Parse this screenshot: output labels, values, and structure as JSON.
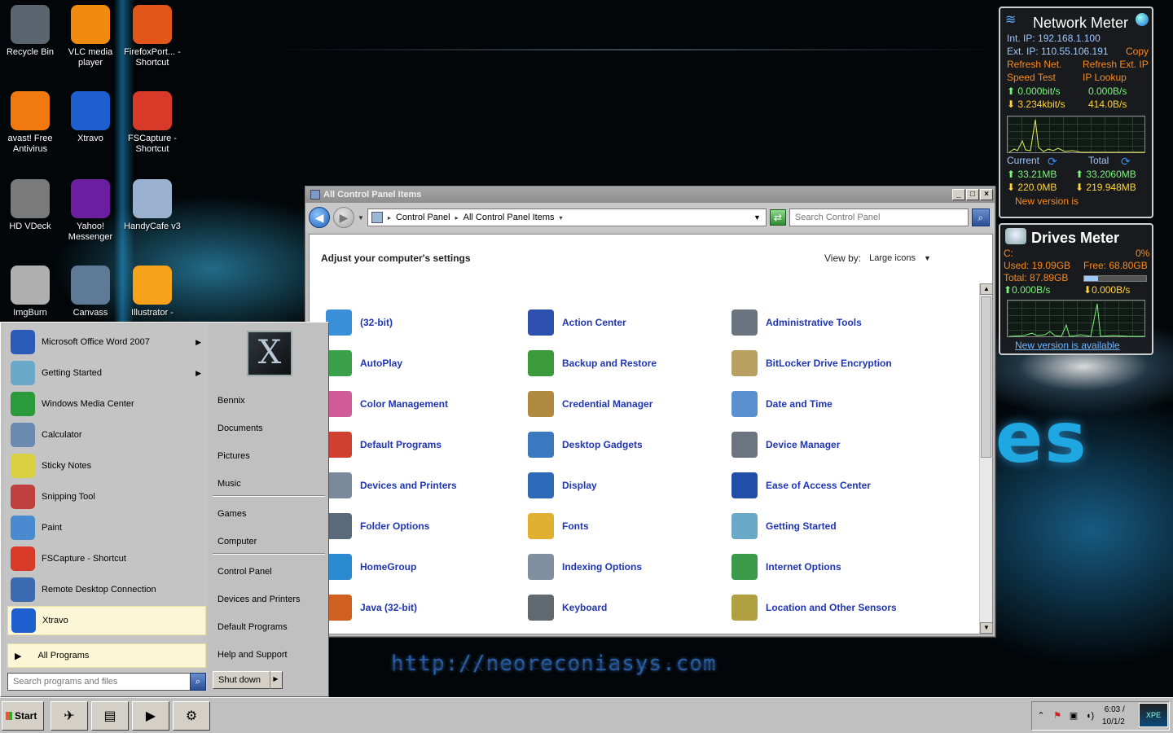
{
  "desktop": {
    "wallpaper_text_es": "es",
    "wallpaper_url": "http://neoreconiasys.com",
    "icons": [
      {
        "label": "Recycle Bin",
        "icon": "recycle-bin-icon",
        "color": "#5a6570"
      },
      {
        "label": "VLC media player",
        "icon": "vlc-cone-icon",
        "color": "#f08a10"
      },
      {
        "label": "FirefoxPort... - Shortcut",
        "icon": "firefox-icon",
        "color": "#e2561a"
      },
      {
        "label": "avast! Free Antivirus",
        "icon": "avast-icon",
        "color": "#f07a10"
      },
      {
        "label": "Xtravo",
        "icon": "xtravo-icon",
        "color": "#1e5fd0"
      },
      {
        "label": "FSCapture - Shortcut",
        "icon": "fscapture-icon",
        "color": "#d83a2a"
      },
      {
        "label": "HD VDeck",
        "icon": "hd-vdeck-icon",
        "color": "#7a7a7a"
      },
      {
        "label": "Yahoo! Messenger",
        "icon": "yahoo-messenger-icon",
        "color": "#6b1fa0"
      },
      {
        "label": "HandyCafe v3",
        "icon": "handycafe-icon",
        "color": "#9ab2d0"
      },
      {
        "label": "ImgBurn",
        "icon": "imgburn-icon",
        "color": "#b0b0b0"
      },
      {
        "label": "Canvass",
        "icon": "canvass-icon",
        "color": "#5e7a96"
      },
      {
        "label": "Illustrator -",
        "icon": "illustrator-icon",
        "color": "#f7a21b"
      }
    ]
  },
  "window": {
    "title": "All Control Panel Items",
    "breadcrumb": [
      "Control Panel",
      "All Control Panel Items"
    ],
    "search_placeholder": "Search Control Panel",
    "heading": "Adjust your computer's settings",
    "view_by_label": "View by:",
    "view_by_value": "Large icons",
    "items": [
      {
        "label": "(32-bit)",
        "icon": "flash-player-icon",
        "color": "#3a8fd8"
      },
      {
        "label": "Action Center",
        "icon": "action-center-flag-icon",
        "color": "#2d4fb0"
      },
      {
        "label": "Administrative Tools",
        "icon": "admin-tools-icon",
        "color": "#6a7480"
      },
      {
        "label": "AutoPlay",
        "icon": "autoplay-icon",
        "color": "#3aa04a"
      },
      {
        "label": "Backup and Restore",
        "icon": "backup-restore-icon",
        "color": "#3b9a3b"
      },
      {
        "label": "BitLocker Drive Encryption",
        "icon": "bitlocker-key-icon",
        "color": "#b8a060"
      },
      {
        "label": "Color Management",
        "icon": "color-management-icon",
        "color": "#d05a9a"
      },
      {
        "label": "Credential Manager",
        "icon": "credential-manager-icon",
        "color": "#b08a40"
      },
      {
        "label": "Date and Time",
        "icon": "date-time-icon",
        "color": "#5a8fd0"
      },
      {
        "label": "Default Programs",
        "icon": "default-programs-icon",
        "color": "#d04030"
      },
      {
        "label": "Desktop Gadgets",
        "icon": "desktop-gadgets-icon",
        "color": "#3a78c0"
      },
      {
        "label": "Device Manager",
        "icon": "device-manager-icon",
        "color": "#6c7480"
      },
      {
        "label": "Devices and Printers",
        "icon": "devices-printers-icon",
        "color": "#7a8a9a"
      },
      {
        "label": "Display",
        "icon": "display-icon",
        "color": "#2a6ab8"
      },
      {
        "label": "Ease of Access Center",
        "icon": "ease-of-access-icon",
        "color": "#1f4fa8"
      },
      {
        "label": "Folder Options",
        "icon": "folder-options-icon",
        "color": "#5a6a7a"
      },
      {
        "label": "Fonts",
        "icon": "fonts-icon",
        "color": "#e0b030"
      },
      {
        "label": "Getting Started",
        "icon": "getting-started-icon",
        "color": "#6aa8c8"
      },
      {
        "label": "HomeGroup",
        "icon": "homegroup-icon",
        "color": "#2a8ad0"
      },
      {
        "label": "Indexing Options",
        "icon": "indexing-options-icon",
        "color": "#8090a0"
      },
      {
        "label": "Internet Options",
        "icon": "internet-options-icon",
        "color": "#3a9a4a"
      },
      {
        "label": "Java (32-bit)",
        "icon": "java-icon",
        "color": "#d06020"
      },
      {
        "label": "Keyboard",
        "icon": "keyboard-icon",
        "color": "#606870"
      },
      {
        "label": "Location and Other Sensors",
        "icon": "location-sensors-icon",
        "color": "#b0a040"
      }
    ]
  },
  "start_menu": {
    "programs": [
      {
        "label": "Microsoft Office Word 2007",
        "icon": "word-icon",
        "color": "#2b5bb8",
        "submenu": true
      },
      {
        "label": "Getting Started",
        "icon": "getting-started-icon",
        "color": "#6aa8c8",
        "submenu": true
      },
      {
        "label": "Windows Media Center",
        "icon": "media-center-icon",
        "color": "#2a9a3a",
        "submenu": false
      },
      {
        "label": "Calculator",
        "icon": "calculator-icon",
        "color": "#6a8ab0",
        "submenu": false
      },
      {
        "label": "Sticky Notes",
        "icon": "sticky-notes-icon",
        "color": "#d8d040",
        "submenu": false
      },
      {
        "label": "Snipping Tool",
        "icon": "snipping-tool-icon",
        "color": "#c04040",
        "submenu": false
      },
      {
        "label": "Paint",
        "icon": "paint-icon",
        "color": "#4a8ad0",
        "submenu": false
      },
      {
        "label": "FSCapture - Shortcut",
        "icon": "fscapture-icon",
        "color": "#d83a2a",
        "submenu": false
      },
      {
        "label": "Remote Desktop Connection",
        "icon": "remote-desktop-icon",
        "color": "#3a6ab0",
        "submenu": false
      },
      {
        "label": "Xtravo",
        "icon": "xtravo-icon",
        "color": "#1e5fd0",
        "submenu": false
      }
    ],
    "all_programs": "All Programs",
    "search_placeholder": "Search programs and files",
    "right_links_group1": [
      "Bennix",
      "Documents",
      "Pictures",
      "Music"
    ],
    "right_links_group2": [
      "Games",
      "Computer"
    ],
    "right_links_group3": [
      "Control Panel",
      "Devices and Printers",
      "Default Programs",
      "Help and Support"
    ],
    "shutdown": "Shut down"
  },
  "network_meter": {
    "title": "Network Meter",
    "int_ip_label": "Int. IP:",
    "int_ip": "192.168.1.100",
    "ext_ip_label": "Ext. IP:",
    "ext_ip": "110.55.106.191",
    "copy": "Copy",
    "refresh_net": "Refresh Net.",
    "refresh_ext_ip": "Refresh Ext. IP",
    "speed_test": "Speed Test",
    "ip_lookup": "IP Lookup",
    "up_rate_bits": "0.000bit/s",
    "up_rate_bytes": "0.000B/s",
    "down_rate_bits": "3.234kbit/s",
    "down_rate_bytes": "414.0B/s",
    "current_label": "Current",
    "total_label": "Total",
    "current_up": "33.21MB",
    "total_up": "33.2060MB",
    "current_down": "220.0MB",
    "total_down": "219.948MB",
    "new_version": "New version is"
  },
  "drives_meter": {
    "title": "Drives Meter",
    "drive": "C:",
    "percent": "0%",
    "used": "Used: 19.09GB",
    "free": "Free: 68.80GB",
    "total": "Total: 87.89GB",
    "usage_fraction": 0.22,
    "read_rate": "0.000B/s",
    "write_rate": "0.000B/s",
    "new_version_link": "New version is available"
  },
  "taskbar": {
    "start_label": "Start",
    "tasks": [
      {
        "icon": "xtravo-task-icon"
      },
      {
        "icon": "explorer-folder-icon"
      },
      {
        "icon": "media-player-icon"
      },
      {
        "icon": "control-panel-task-icon"
      }
    ],
    "clock_time": "6:03 /",
    "clock_date": "10/1/2",
    "desk_button": "XPE"
  },
  "colors": {
    "link_blue": "#1f35b5",
    "gadget_orange": "#fc8a1c",
    "gadget_blue": "#9ec9ff",
    "gadget_green": "#7cf37a",
    "gadget_yellow": "#ffd43b"
  }
}
